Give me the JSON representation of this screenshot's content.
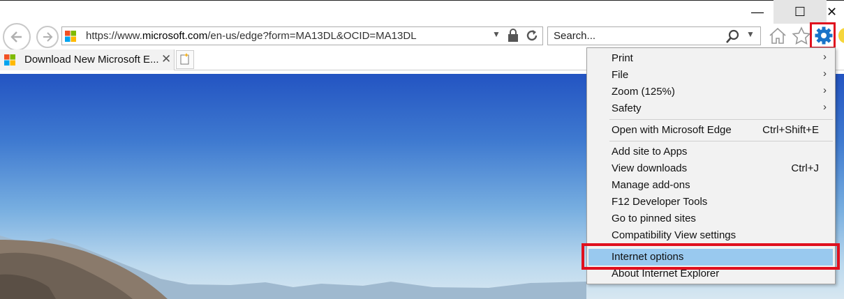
{
  "window": {
    "minimize_glyph": "—",
    "maximize_glyph": "☐",
    "close_glyph": "✕"
  },
  "address_bar": {
    "url_prefix": "https://www.",
    "url_domain": "microsoft.com",
    "url_rest": "/en-us/edge?form=MA13DL&OCID=MA13DL"
  },
  "search_bar": {
    "placeholder": "Search..."
  },
  "tab": {
    "title": "Download New Microsoft E...",
    "close_glyph": "✕"
  },
  "tools_menu": {
    "items": [
      {
        "label": "Print",
        "submenu": true
      },
      {
        "label": "File",
        "submenu": true
      },
      {
        "label": "Zoom (125%)",
        "submenu": true
      },
      {
        "label": "Safety",
        "submenu": true
      },
      {
        "label": "Open with Microsoft Edge",
        "shortcut": "Ctrl+Shift+E"
      },
      {
        "label": "Add site to Apps"
      },
      {
        "label": "View downloads",
        "shortcut": "Ctrl+J"
      },
      {
        "label": "Manage add-ons"
      },
      {
        "label": "F12 Developer Tools"
      },
      {
        "label": "Go to pinned sites"
      },
      {
        "label": "Compatibility View settings"
      },
      {
        "label": "Internet options",
        "selected": true
      },
      {
        "label": "About Internet Explorer"
      }
    ],
    "submenu_arrow": "›"
  },
  "colors": {
    "highlight_red": "#e0101e",
    "selected_item": "#99c9ef",
    "gear_blue": "#1a73c8"
  },
  "icons": [
    "back-arrow-icon",
    "forward-arrow-icon",
    "microsoft-logo-icon",
    "lock-icon",
    "refresh-icon",
    "search-icon",
    "home-icon",
    "favorites-star-icon",
    "gear-icon",
    "smiley-icon",
    "new-tab-icon"
  ]
}
